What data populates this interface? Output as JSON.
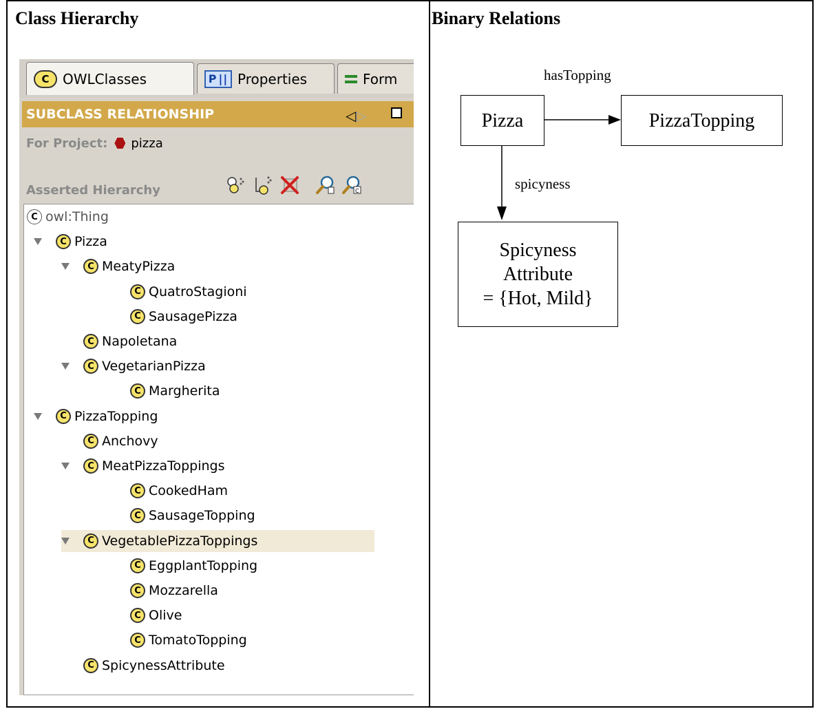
{
  "titles": {
    "left": "Class Hierarchy",
    "right": "Binary Relations"
  },
  "tabs": [
    {
      "icon": "C",
      "label": "OWLClasses"
    },
    {
      "icon": "P",
      "label": "Properties"
    },
    {
      "icon": "=",
      "label": "Form"
    }
  ],
  "header": {
    "title": "SUBCLASS RELATIONSHIP"
  },
  "project": {
    "label": "For Project:",
    "name": "pizza"
  },
  "hierarchy": {
    "label": "Asserted Hierarchy"
  },
  "tree": [
    {
      "label": "owl:Thing",
      "level": 0,
      "expanded": false
    },
    {
      "label": "Pizza",
      "level": 1,
      "expanded": true
    },
    {
      "label": "MeatyPizza",
      "level": 2,
      "expanded": true
    },
    {
      "label": "QuatroStagioni",
      "level": 3,
      "expanded": false
    },
    {
      "label": "SausagePizza",
      "level": 3,
      "expanded": false
    },
    {
      "label": "Napoletana",
      "level": 2,
      "expanded": false
    },
    {
      "label": "VegetarianPizza",
      "level": 2,
      "expanded": true
    },
    {
      "label": "Margherita",
      "level": 3,
      "expanded": false
    },
    {
      "label": "PizzaTopping",
      "level": 1,
      "expanded": true
    },
    {
      "label": "Anchovy",
      "level": 2,
      "expanded": false
    },
    {
      "label": "MeatPizzaToppings",
      "level": 2,
      "expanded": true
    },
    {
      "label": "CookedHam",
      "level": 3,
      "expanded": false
    },
    {
      "label": "SausageTopping",
      "level": 3,
      "expanded": false
    },
    {
      "label": "VegetablePizzaToppings",
      "level": 2,
      "expanded": true,
      "selected": true
    },
    {
      "label": "EggplantTopping",
      "level": 3,
      "expanded": false
    },
    {
      "label": "Mozzarella",
      "level": 3,
      "expanded": false
    },
    {
      "label": "Olive",
      "level": 3,
      "expanded": false
    },
    {
      "label": "TomatoTopping",
      "level": 3,
      "expanded": false
    },
    {
      "label": "SpicynessAttribute",
      "level": 2,
      "expanded": false
    }
  ],
  "diagram": {
    "nodes": {
      "pizza": "Pizza",
      "topping": "PizzaTopping",
      "spicy_1": "Spicyness",
      "spicy_2": "Attribute",
      "spicy_3": "= {Hot, Mild}"
    },
    "edges": {
      "has_topping": "hasTopping",
      "spicyness": "spicyness"
    }
  },
  "colors": {
    "header_bg": "#d2a84a",
    "class_icon": "#f6e36a",
    "selected_row": "#f1ead7"
  }
}
